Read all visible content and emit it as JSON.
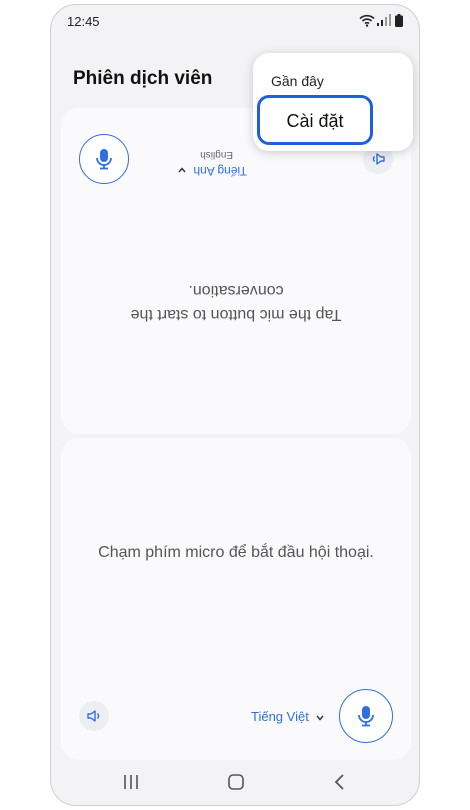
{
  "status": {
    "time": "12:45"
  },
  "app": {
    "title": "Phiên dịch viên"
  },
  "menu": {
    "recent_label": "Gần đây",
    "settings_label": "Cài đặt"
  },
  "partner": {
    "language": "Tiếng Anh",
    "language_sub": "English",
    "prompt": "Tap the mic button to start the conversation."
  },
  "user": {
    "language": "Tiếng Việt",
    "prompt": "Chạm phím micro để bắt đầu hội thoại."
  },
  "colors": {
    "accent": "#2f6fe0",
    "highlight": "#1f5fdc"
  },
  "icons": [
    "wifi-icon",
    "signal-icon",
    "battery-icon",
    "mic-icon",
    "speaker-icon",
    "chevron-down-icon",
    "recents-icon",
    "home-icon",
    "back-icon"
  ]
}
